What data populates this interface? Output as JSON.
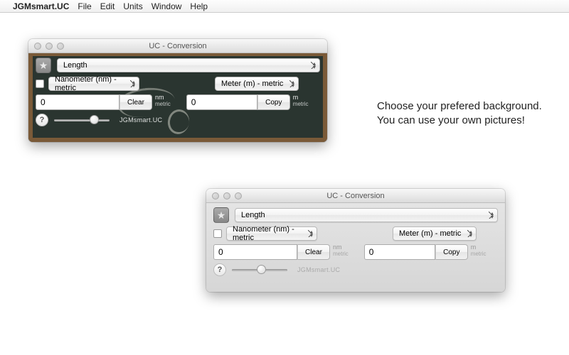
{
  "menubar": {
    "apple": "",
    "app_name": "JGMsmart.UC",
    "items": [
      "File",
      "Edit",
      "Units",
      "Window",
      "Help"
    ]
  },
  "promo": {
    "line1": "Choose your prefered background.",
    "line2": "You can use your own pictures!"
  },
  "window": {
    "title": "UC - Conversion",
    "category": "Length",
    "lock_checked": false,
    "from_unit": "Nanometer (nm) - metric",
    "to_unit": "Meter (m) - metric",
    "from_value": "0",
    "to_value": "0",
    "clear_label": "Clear",
    "copy_label": "Copy",
    "from_abbr": "nm",
    "from_system": "metric",
    "to_abbr": "m",
    "to_system": "metric",
    "brand": "JGMsmart.UC",
    "help": "?",
    "star": "★"
  }
}
